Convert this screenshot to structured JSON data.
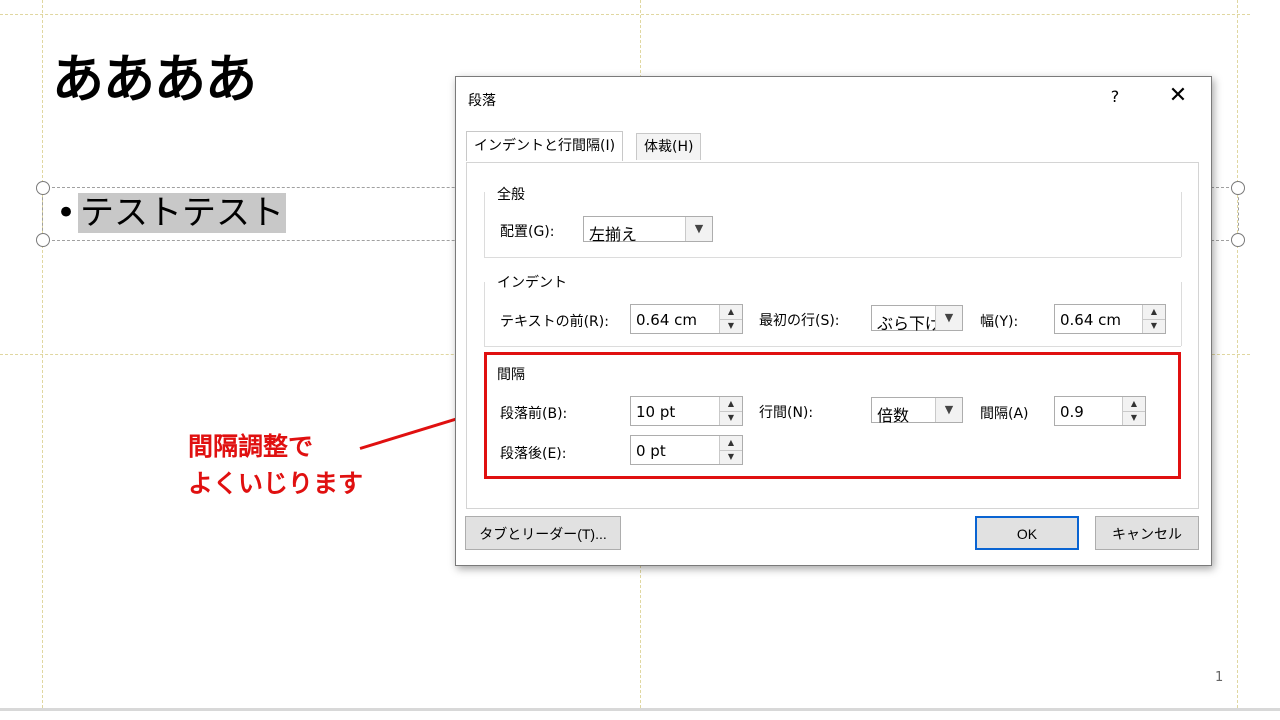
{
  "slide": {
    "title": "ああああ",
    "bullet_marker": "•",
    "bullet_text": "テストテスト",
    "page_number": "1"
  },
  "callout": {
    "line1": "間隔調整で",
    "line2": "よくいじります",
    "color": "#e01010"
  },
  "dialog": {
    "title": "段落",
    "help_label": "?",
    "close_label": "✕",
    "tabs": [
      {
        "label": "インデントと行間隔(I)",
        "active": true
      },
      {
        "label": "体裁(H)",
        "active": false
      }
    ],
    "general": {
      "title": "全般",
      "alignment_label": "配置(G):",
      "alignment_value": "左揃え"
    },
    "indent": {
      "title": "インデント",
      "before_text_label": "テキストの前(R):",
      "before_text_value": "0.64 cm",
      "first_line_label": "最初の行(S):",
      "first_line_value": "ぶら下げ",
      "by_label": "幅(Y):",
      "by_value": "0.64 cm"
    },
    "spacing": {
      "title": "間隔",
      "before_label": "段落前(B):",
      "before_value": "10 pt",
      "after_label": "段落後(E):",
      "after_value": "0 pt",
      "line_spacing_label": "行間(N):",
      "line_spacing_value": "倍数",
      "at_label": "間隔(A)",
      "at_value": "0.9"
    },
    "tabs_button": "タブとリーダー(T)...",
    "ok_button": "OK",
    "cancel_button": "キャンセル"
  }
}
